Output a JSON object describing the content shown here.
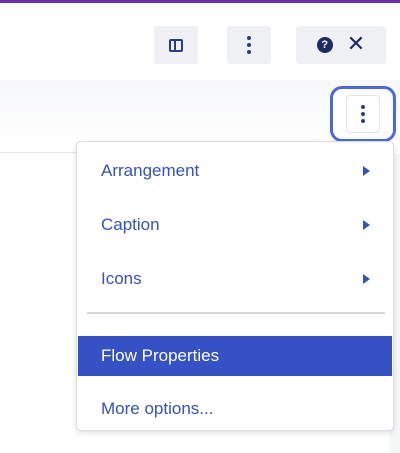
{
  "colors": {
    "accent": "#3452c5",
    "focus_ring": "#4a68df",
    "toolbar_bg": "#eef0f3",
    "top_accent": "#6a2fb3"
  },
  "toolbar": {
    "panel_icon": "sidebar-panel-icon",
    "more_icon": "vertical-dots-icon",
    "help_icon": "question-circle-icon",
    "help_glyph": "?",
    "close_icon": "close-icon",
    "close_glyph": "✕"
  },
  "options_button": {
    "icon": "vertical-dots-icon"
  },
  "menu": {
    "items": [
      {
        "label": "Arrangement",
        "has_submenu": true
      },
      {
        "label": "Caption",
        "has_submenu": true
      },
      {
        "label": "Icons",
        "has_submenu": true
      },
      {
        "label": "Flow Properties",
        "selected": true
      },
      {
        "label": "More options..."
      }
    ]
  }
}
